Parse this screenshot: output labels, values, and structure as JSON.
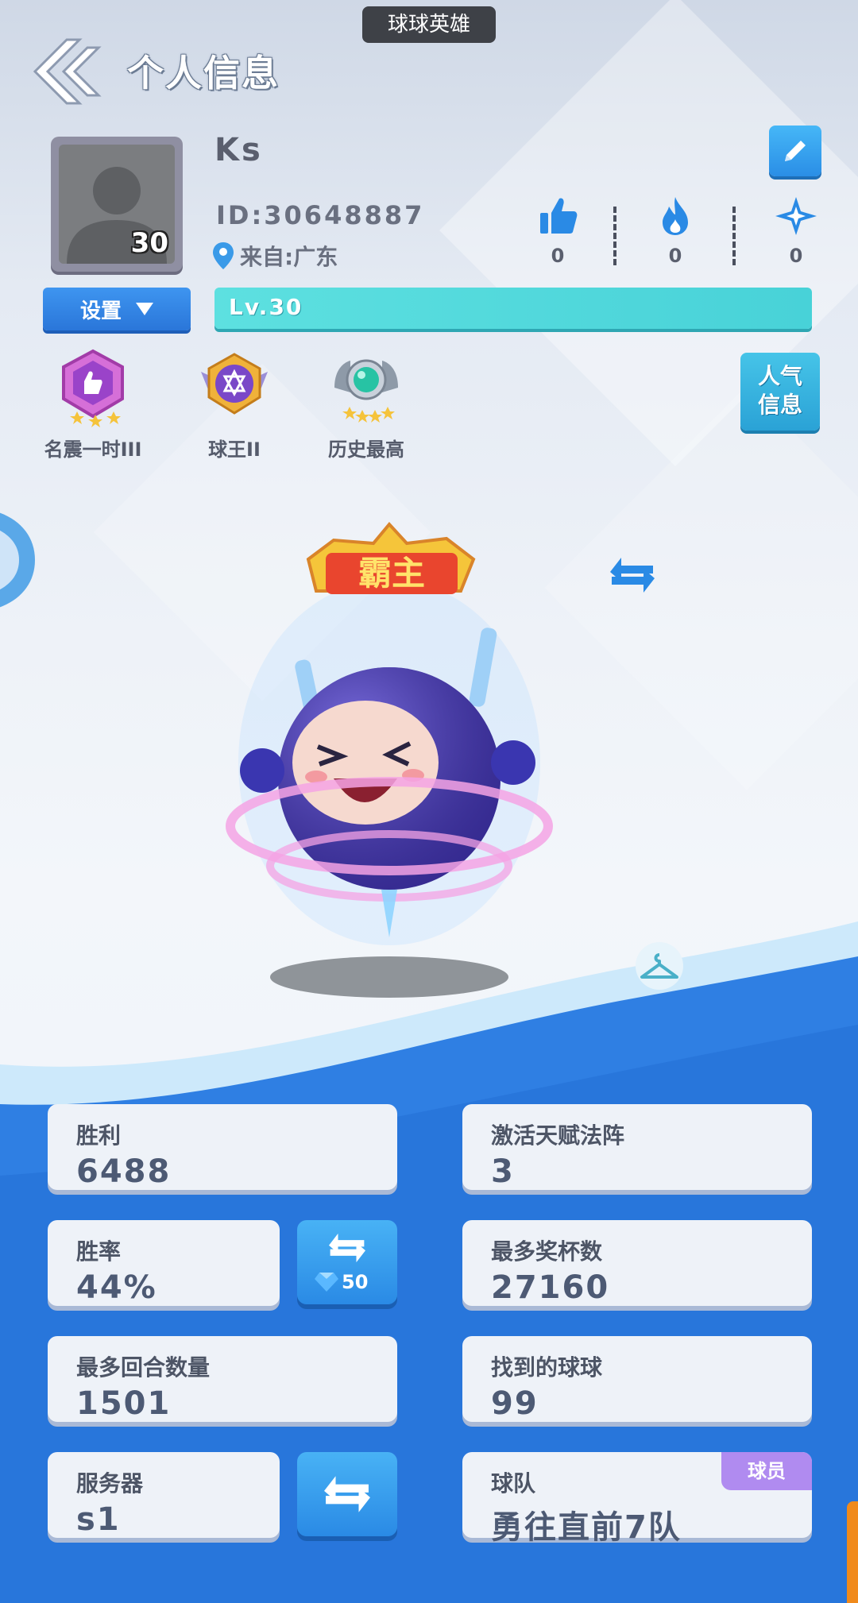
{
  "app": {
    "window_title": "球球英雄"
  },
  "header": {
    "title": "个人信息"
  },
  "profile": {
    "username": "Ks",
    "id_text": "ID:30648887",
    "location_text": "来自:广东",
    "avatar_level": "30",
    "level_label": "Lv.30",
    "settings_label": "设置"
  },
  "stats": [
    {
      "icon": "thumbs-up-icon",
      "value": "0"
    },
    {
      "icon": "flame-icon",
      "value": "0"
    },
    {
      "icon": "star-sparkle-icon",
      "value": "0"
    }
  ],
  "badges": [
    {
      "label": "名震一时III",
      "icon": "fame-badge-icon"
    },
    {
      "label": "球王II",
      "icon": "ball-king-badge-icon"
    },
    {
      "label": "历史最高",
      "icon": "history-best-badge-icon"
    }
  ],
  "popularity_button": {
    "line1": "人气",
    "line2": "信息"
  },
  "character": {
    "title_banner": "霸主"
  },
  "cards": {
    "wins": {
      "label": "胜利",
      "value": "6488"
    },
    "talent": {
      "label": "激活天赋法阵",
      "value": "3"
    },
    "win_rate": {
      "label": "胜率",
      "value": "44%"
    },
    "trophies": {
      "label": "最多奖杯数",
      "value": "27160"
    },
    "rounds": {
      "label": "最多回合数量",
      "value": "1501"
    },
    "balls_found": {
      "label": "找到的球球",
      "value": "99"
    },
    "server": {
      "label": "服务器",
      "value": "s1"
    },
    "team": {
      "label": "球队",
      "value": "勇往直前7队",
      "tag": "球员"
    }
  },
  "refresh_cost": "50",
  "colors": {
    "accent_blue": "#2a80e0",
    "cyan_bar": "#48d2d8",
    "member_purple": "#b08bf0"
  }
}
